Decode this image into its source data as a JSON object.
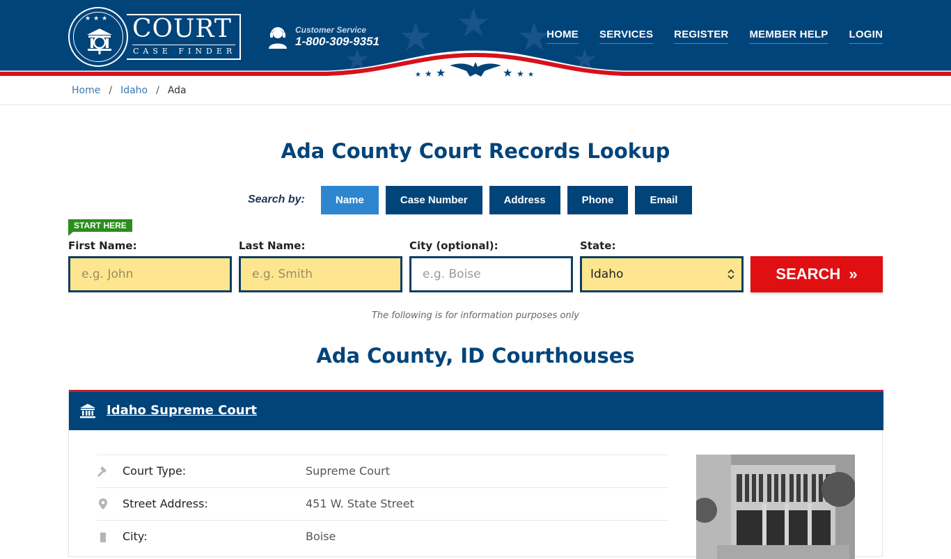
{
  "header": {
    "logo": {
      "main": "COURT",
      "sub": "CASE FINDER"
    },
    "customer_service": {
      "label": "Customer Service",
      "phone": "1-800-309-9351"
    },
    "nav": [
      "HOME",
      "SERVICES",
      "REGISTER",
      "MEMBER HELP",
      "LOGIN"
    ],
    "colors": {
      "navy": "#01447a",
      "red": "#d6111c"
    }
  },
  "breadcrumb": [
    "Home",
    "Idaho",
    "Ada"
  ],
  "page_title": "Ada County Court Records Lookup",
  "search": {
    "search_by_label": "Search by:",
    "tabs": [
      {
        "label": "Name",
        "active": true
      },
      {
        "label": "Case Number",
        "active": false
      },
      {
        "label": "Address",
        "active": false
      },
      {
        "label": "Phone",
        "active": false
      },
      {
        "label": "Email",
        "active": false
      }
    ],
    "start_here": "START HERE",
    "fields": {
      "first_name": {
        "label": "First Name:",
        "placeholder": "e.g. John",
        "value": ""
      },
      "last_name": {
        "label": "Last Name:",
        "placeholder": "e.g. Smith",
        "value": ""
      },
      "city": {
        "label": "City (optional):",
        "placeholder": "e.g.  Boise",
        "value": ""
      },
      "state": {
        "label": "State:",
        "value": "Idaho"
      }
    },
    "button": "SEARCH",
    "button_icon": "»"
  },
  "info_note": "The following is for information purposes only",
  "section_title": "Ada County, ID Courthouses",
  "courthouse": {
    "name": "Idaho Supreme Court",
    "rows": [
      {
        "icon": "gavel-icon",
        "label": "Court Type:",
        "value": "Supreme Court"
      },
      {
        "icon": "map-pin-icon",
        "label": "Street Address:",
        "value": "451 W. State Street"
      },
      {
        "icon": "building-icon",
        "label": "City:",
        "value": "Boise"
      }
    ]
  }
}
